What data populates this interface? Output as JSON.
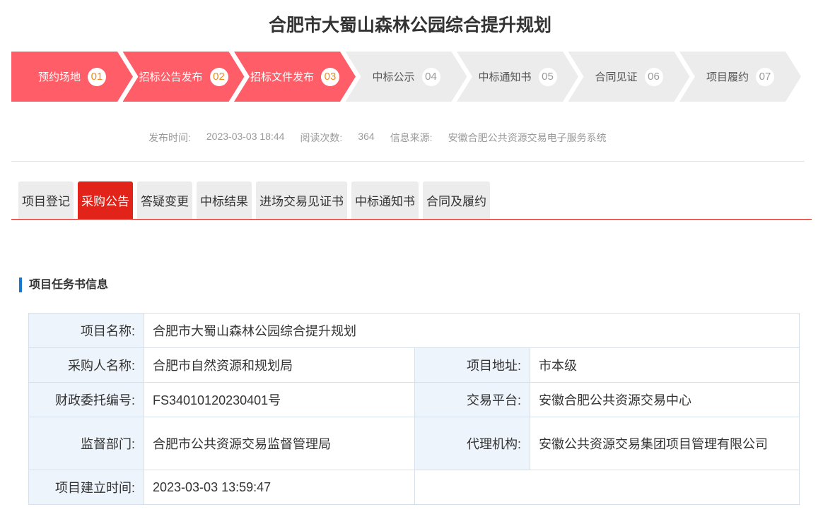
{
  "title": "合肥市大蜀山森林公园综合提升规划",
  "steps": [
    {
      "label": "预约场地",
      "num": "01",
      "done": true
    },
    {
      "label": "招标公告发布",
      "num": "02",
      "done": true
    },
    {
      "label": "招标文件发布",
      "num": "03",
      "done": true
    },
    {
      "label": "中标公示",
      "num": "04",
      "done": false
    },
    {
      "label": "中标通知书",
      "num": "05",
      "done": false
    },
    {
      "label": "合同见证",
      "num": "06",
      "done": false
    },
    {
      "label": "项目履约",
      "num": "07",
      "done": false
    }
  ],
  "meta": {
    "publish_label": "发布时间:",
    "publish_time": "2023-03-03 18:44",
    "reads_label": "阅读次数:",
    "reads": "364",
    "source_label": "信息来源:",
    "source": "安徽合肥公共资源交易电子服务系统"
  },
  "tabs": [
    "项目登记",
    "采购公告",
    "答疑变更",
    "中标结果",
    "进场交易见证书",
    "中标通知书",
    "合同及履约"
  ],
  "active_tab": 1,
  "section_title": "项目任务书信息",
  "info": {
    "name_l": "项目名称:",
    "name": "合肥市大蜀山森林公园综合提升规划",
    "buyer_l": "采购人名称:",
    "buyer": "合肥市自然资源和规划局",
    "addr_l": "项目地址:",
    "addr": "市本级",
    "fin_l": "财政委托编号:",
    "fin": "FS34010120230401号",
    "platform_l": "交易平台:",
    "platform": "安徽合肥公共资源交易中心",
    "super_l": "监督部门:",
    "super": "合肥市公共资源交易监督管理局",
    "agent_l": "代理机构:",
    "agent": "安徽公共资源交易集团项目管理有限公司",
    "created_l": "项目建立时间:",
    "created": "2023-03-03 13:59:47"
  }
}
